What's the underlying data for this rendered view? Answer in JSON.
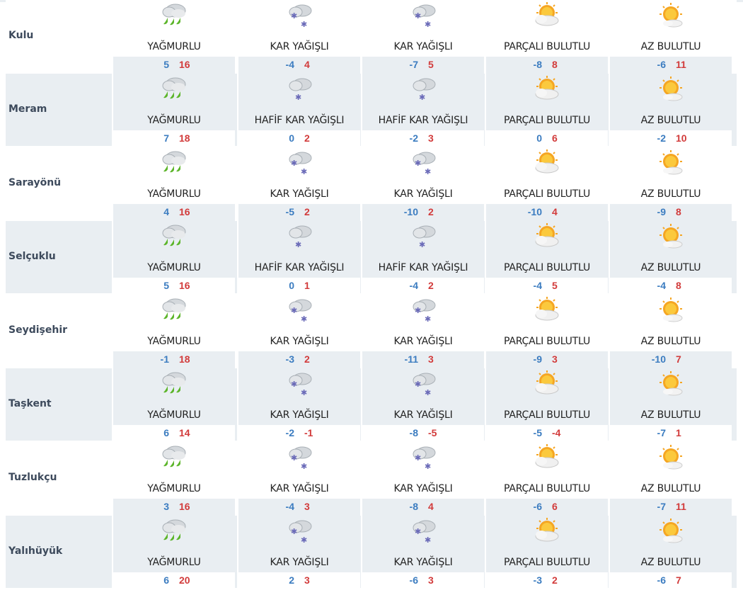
{
  "rows": [
    {
      "district": "Kulu",
      "days": [
        {
          "icon": "rain-icon",
          "desc": "YAĞMURLU",
          "min": "5",
          "max": "16"
        },
        {
          "icon": "snow-icon",
          "desc": "KAR YAĞIŞLI",
          "min": "-4",
          "max": "4"
        },
        {
          "icon": "snow-icon",
          "desc": "KAR YAĞIŞLI",
          "min": "-7",
          "max": "5"
        },
        {
          "icon": "partly-cloudy-icon",
          "desc": "PARÇALI BULUTLU",
          "min": "-8",
          "max": "8"
        },
        {
          "icon": "mostly-sunny-icon",
          "desc": "AZ BULUTLU",
          "min": "-6",
          "max": "11"
        }
      ]
    },
    {
      "district": "Meram",
      "days": [
        {
          "icon": "rain-icon",
          "desc": "YAĞMURLU",
          "min": "7",
          "max": "18"
        },
        {
          "icon": "light-snow-icon",
          "desc": "HAFİF KAR YAĞIŞLI",
          "min": "0",
          "max": "2"
        },
        {
          "icon": "light-snow-icon",
          "desc": "HAFİF KAR YAĞIŞLI",
          "min": "-2",
          "max": "3"
        },
        {
          "icon": "partly-cloudy-icon",
          "desc": "PARÇALI BULUTLU",
          "min": "0",
          "max": "6"
        },
        {
          "icon": "mostly-sunny-icon",
          "desc": "AZ BULUTLU",
          "min": "-2",
          "max": "10"
        }
      ]
    },
    {
      "district": "Sarayönü",
      "days": [
        {
          "icon": "rain-icon",
          "desc": "YAĞMURLU",
          "min": "4",
          "max": "16"
        },
        {
          "icon": "snow-icon",
          "desc": "KAR YAĞIŞLI",
          "min": "-5",
          "max": "2"
        },
        {
          "icon": "snow-icon",
          "desc": "KAR YAĞIŞLI",
          "min": "-10",
          "max": "2"
        },
        {
          "icon": "partly-cloudy-icon",
          "desc": "PARÇALI BULUTLU",
          "min": "-10",
          "max": "4"
        },
        {
          "icon": "mostly-sunny-icon",
          "desc": "AZ BULUTLU",
          "min": "-9",
          "max": "8"
        }
      ]
    },
    {
      "district": "Selçuklu",
      "days": [
        {
          "icon": "rain-icon",
          "desc": "YAĞMURLU",
          "min": "5",
          "max": "16"
        },
        {
          "icon": "light-snow-icon",
          "desc": "HAFİF KAR YAĞIŞLI",
          "min": "0",
          "max": "1"
        },
        {
          "icon": "light-snow-icon",
          "desc": "HAFİF KAR YAĞIŞLI",
          "min": "-4",
          "max": "2"
        },
        {
          "icon": "partly-cloudy-icon",
          "desc": "PARÇALI BULUTLU",
          "min": "-4",
          "max": "5"
        },
        {
          "icon": "mostly-sunny-icon",
          "desc": "AZ BULUTLU",
          "min": "-4",
          "max": "8"
        }
      ]
    },
    {
      "district": "Seydişehir",
      "days": [
        {
          "icon": "rain-icon",
          "desc": "YAĞMURLU",
          "min": "-1",
          "max": "18"
        },
        {
          "icon": "snow-icon",
          "desc": "KAR YAĞIŞLI",
          "min": "-3",
          "max": "2"
        },
        {
          "icon": "snow-icon",
          "desc": "KAR YAĞIŞLI",
          "min": "-11",
          "max": "3"
        },
        {
          "icon": "partly-cloudy-icon",
          "desc": "PARÇALI BULUTLU",
          "min": "-9",
          "max": "3"
        },
        {
          "icon": "mostly-sunny-icon",
          "desc": "AZ BULUTLU",
          "min": "-10",
          "max": "7"
        }
      ]
    },
    {
      "district": "Taşkent",
      "days": [
        {
          "icon": "rain-icon",
          "desc": "YAĞMURLU",
          "min": "6",
          "max": "14"
        },
        {
          "icon": "snow-icon",
          "desc": "KAR YAĞIŞLI",
          "min": "-2",
          "max": "-1"
        },
        {
          "icon": "snow-icon",
          "desc": "KAR YAĞIŞLI",
          "min": "-8",
          "max": "-5"
        },
        {
          "icon": "partly-cloudy-icon",
          "desc": "PARÇALI BULUTLU",
          "min": "-5",
          "max": "-4"
        },
        {
          "icon": "mostly-sunny-icon",
          "desc": "AZ BULUTLU",
          "min": "-7",
          "max": "1"
        }
      ]
    },
    {
      "district": "Tuzlukçu",
      "days": [
        {
          "icon": "rain-icon",
          "desc": "YAĞMURLU",
          "min": "3",
          "max": "16"
        },
        {
          "icon": "snow-icon",
          "desc": "KAR YAĞIŞLI",
          "min": "-4",
          "max": "3"
        },
        {
          "icon": "snow-icon",
          "desc": "KAR YAĞIŞLI",
          "min": "-8",
          "max": "4"
        },
        {
          "icon": "partly-cloudy-icon",
          "desc": "PARÇALI BULUTLU",
          "min": "-6",
          "max": "6"
        },
        {
          "icon": "mostly-sunny-icon",
          "desc": "AZ BULUTLU",
          "min": "-7",
          "max": "11"
        }
      ]
    },
    {
      "district": "Yalıhüyük",
      "days": [
        {
          "icon": "rain-icon",
          "desc": "YAĞMURLU",
          "min": "6",
          "max": "20"
        },
        {
          "icon": "snow-icon",
          "desc": "KAR YAĞIŞLI",
          "min": "2",
          "max": "3"
        },
        {
          "icon": "snow-icon",
          "desc": "KAR YAĞIŞLI",
          "min": "-6",
          "max": "3"
        },
        {
          "icon": "partly-cloudy-icon",
          "desc": "PARÇALI BULUTLU",
          "min": "-3",
          "max": "2"
        },
        {
          "icon": "mostly-sunny-icon",
          "desc": "AZ BULUTLU",
          "min": "-6",
          "max": "7"
        }
      ]
    }
  ],
  "colors": {
    "min": "#3b7cc0",
    "max": "#d23b3b",
    "band": "#e9eef2",
    "district": "#3d4a5c"
  }
}
